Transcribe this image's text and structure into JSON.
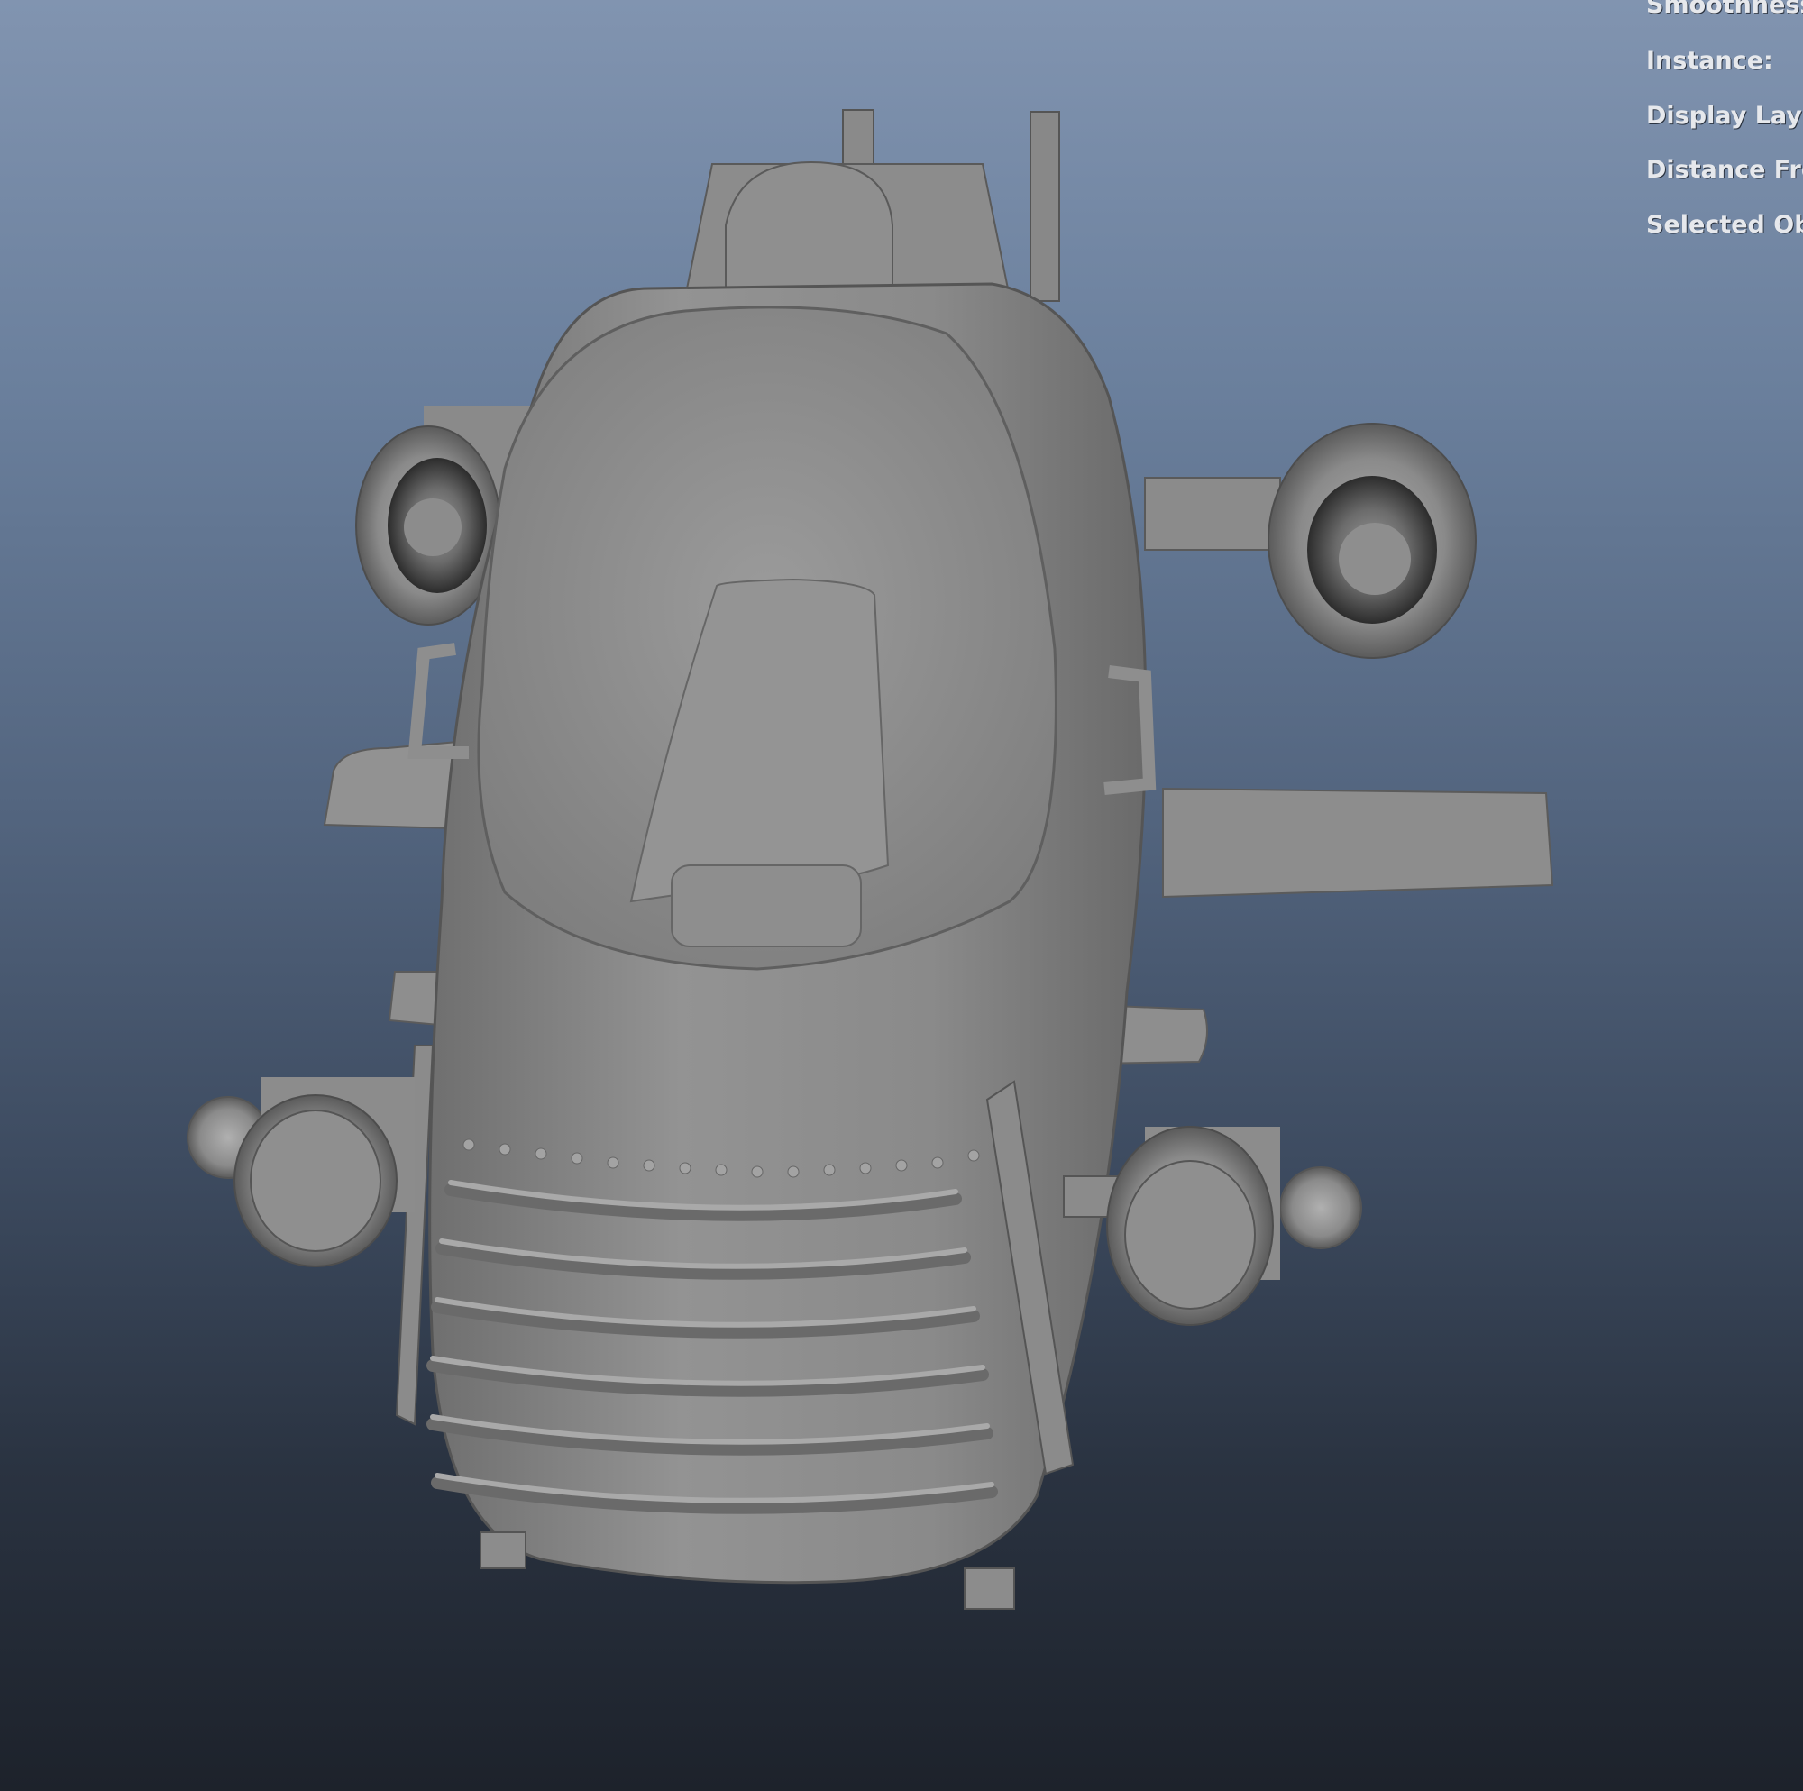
{
  "viewport": {
    "hud": {
      "smoothness_label": "Smoothness:",
      "instance_label": "Instance:",
      "display_layer_label": "Display Layer:",
      "distance_label": "Distance From Camera:",
      "selected_objects_label": "Selected Objects:"
    },
    "model": {
      "icon": "gray-shaded-3d-airship-model"
    },
    "colors": {
      "bg_top": "#8194b0",
      "bg_bottom": "#1d222b",
      "model_gray": "#8e8e8e"
    }
  }
}
